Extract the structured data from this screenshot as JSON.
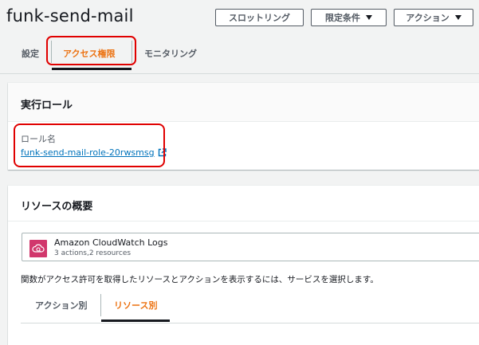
{
  "header": {
    "title": "funk-send-mail",
    "buttons": {
      "throttle": "スロットリング",
      "qualifiers": "限定条件",
      "actions": "アクション"
    }
  },
  "tabs": {
    "settings": "設定",
    "access": "アクセス権限",
    "monitoring": "モニタリング"
  },
  "execution_role": {
    "title": "実行ロール",
    "role_label": "ロール名",
    "role_name": "funk-send-mail-role-20rwsmsg"
  },
  "resource_summary": {
    "title": "リソースの概要",
    "service": {
      "name": "Amazon CloudWatch Logs",
      "detail": "3 actions,2 resources"
    },
    "description": "関数がアクセス許可を取得したリソースとアクションを表示するには、サービスを選択します。",
    "subtabs": {
      "by_action": "アクション別",
      "by_resource": "リソース別"
    }
  },
  "colors": {
    "accent": "#ec7211",
    "link": "#0073bb",
    "highlight": "#e00000",
    "cloudwatch": "#d1376c"
  }
}
